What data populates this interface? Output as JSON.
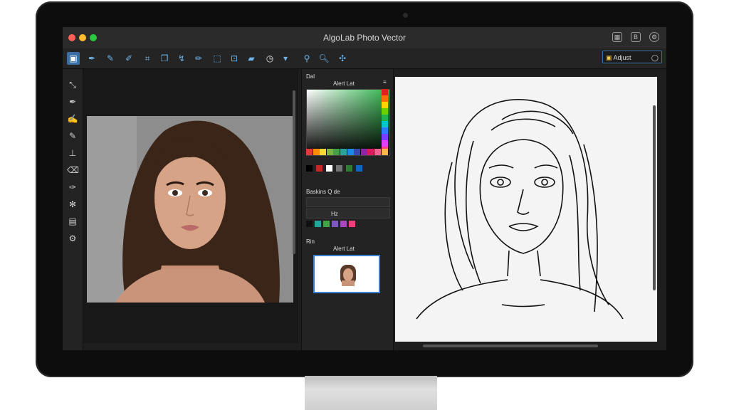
{
  "app": {
    "title": "AlgoLab Photo Vector",
    "window_controls": [
      "close",
      "minimize",
      "maximize"
    ],
    "titlebar_icons": [
      "chart-icon",
      "info-icon",
      "settings-icon"
    ]
  },
  "toolbar": {
    "tools": [
      "image-icon",
      "pen-icon",
      "brush-icon",
      "eyedropper-icon",
      "transform-icon",
      "copy-icon",
      "path-icon",
      "pencil-icon",
      "shapes-icon",
      "crop-icon",
      "fill-icon",
      "timer-icon",
      "layers-icon",
      "paint-icon",
      "zoom-icon",
      "grid-icon"
    ],
    "search_value": "Adjust"
  },
  "left_tools": [
    "wand-icon",
    "pen-icon",
    "brush-icon",
    "pipette-icon",
    "stamp-icon",
    "eraser-icon",
    "pen-nib-icon",
    "dotted-brush-icon",
    "select-rect-icon",
    "gear-icon"
  ],
  "panels": {
    "color": {
      "header": "Dal",
      "subheader": "Alert Lat",
      "swatches_right": [
        "#e02020",
        "#ff6f00",
        "#ffd400",
        "#6bd100",
        "#22b14c",
        "#00c8c8",
        "#2f7bff",
        "#7a3cff",
        "#e040fb",
        "#ff4081"
      ],
      "swatches_bottom": [
        "#e53935",
        "#fb8c00",
        "#fdd835",
        "#7cb342",
        "#43a047",
        "#26a69a",
        "#1e88e5",
        "#3949ab",
        "#8e24aa",
        "#d81b60",
        "#f06292",
        "#ffb74d"
      ],
      "chip_row": [
        "#000000",
        "#c62828",
        "#ffffff",
        "#757575",
        "#2e7d32",
        "#1565c0"
      ]
    },
    "layers": {
      "header": "Baskins Q de",
      "row2": "Hz",
      "chips": [
        "#111111",
        "#26a69a",
        "#43a047",
        "#7e57c2",
        "#ab47bc",
        "#ec407a"
      ]
    },
    "preview": {
      "header": "Rin",
      "subheader": "Alert Lat"
    }
  }
}
